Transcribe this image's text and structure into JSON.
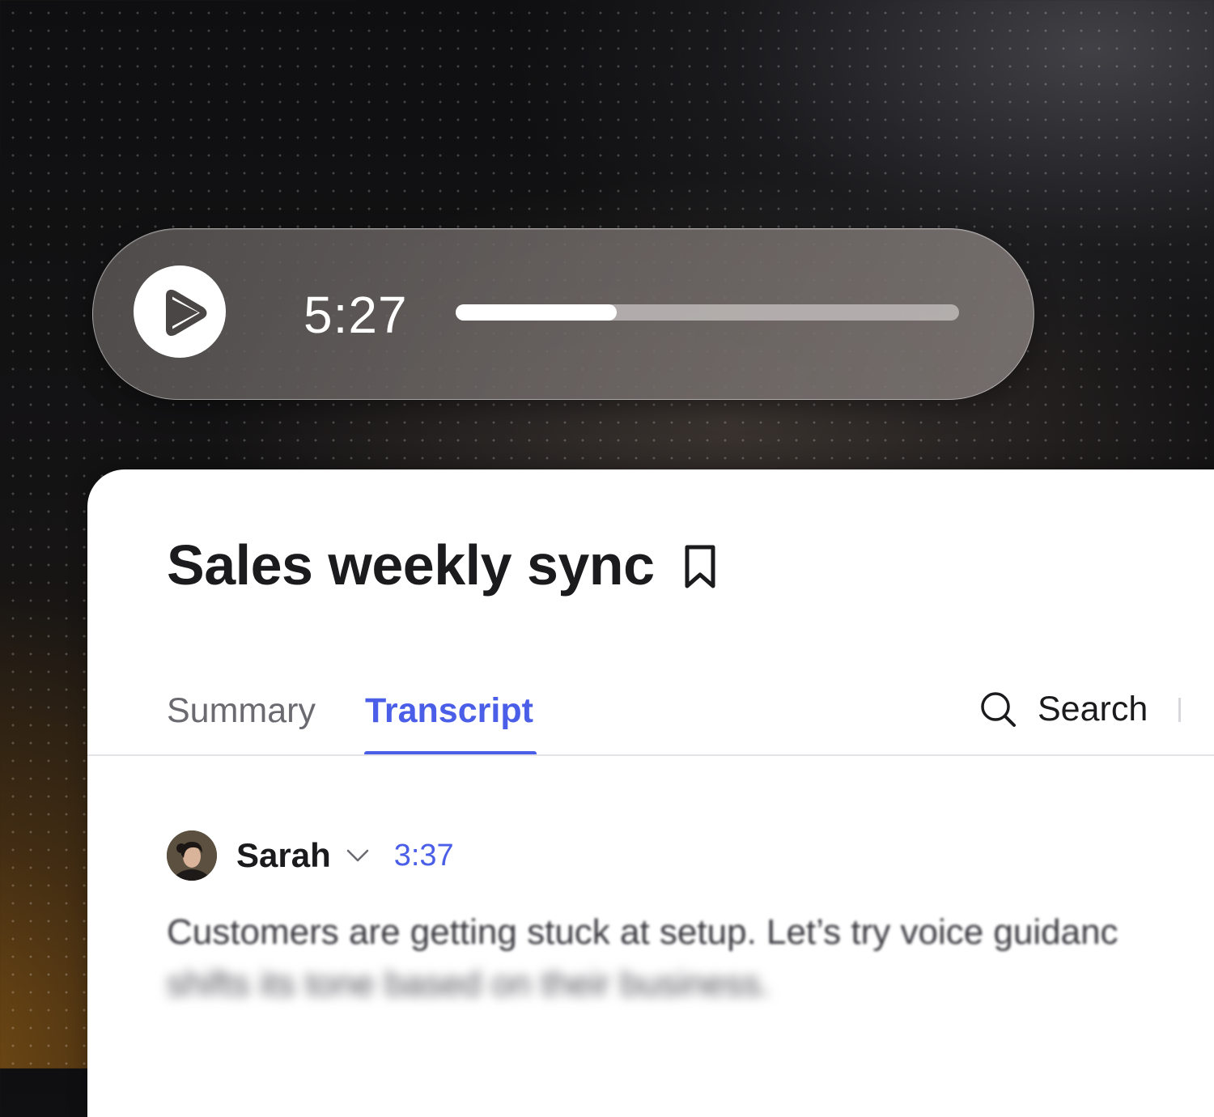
{
  "player": {
    "play_icon": "play-icon",
    "time": "5:27",
    "progress": 0.32,
    "colors": {
      "fill": "#ffffff",
      "track": "#bebab8"
    }
  },
  "meeting": {
    "title": "Sales weekly sync",
    "bookmark_icon": "bookmark-icon"
  },
  "tabs": [
    {
      "label": "Summary",
      "active": false
    },
    {
      "label": "Transcript",
      "active": true
    }
  ],
  "search": {
    "label": "Search",
    "icon": "search-icon"
  },
  "transcript": {
    "entries": [
      {
        "speaker": "Sarah",
        "timestamp": "3:37",
        "text_line1": "Customers are getting stuck at setup. Let’s try voice guidanc",
        "text_line2": "shifts its tone based on their business."
      }
    ]
  },
  "colors": {
    "accent": "#4a5ee8",
    "title": "#1b1b1d",
    "muted": "#6a6a70"
  }
}
